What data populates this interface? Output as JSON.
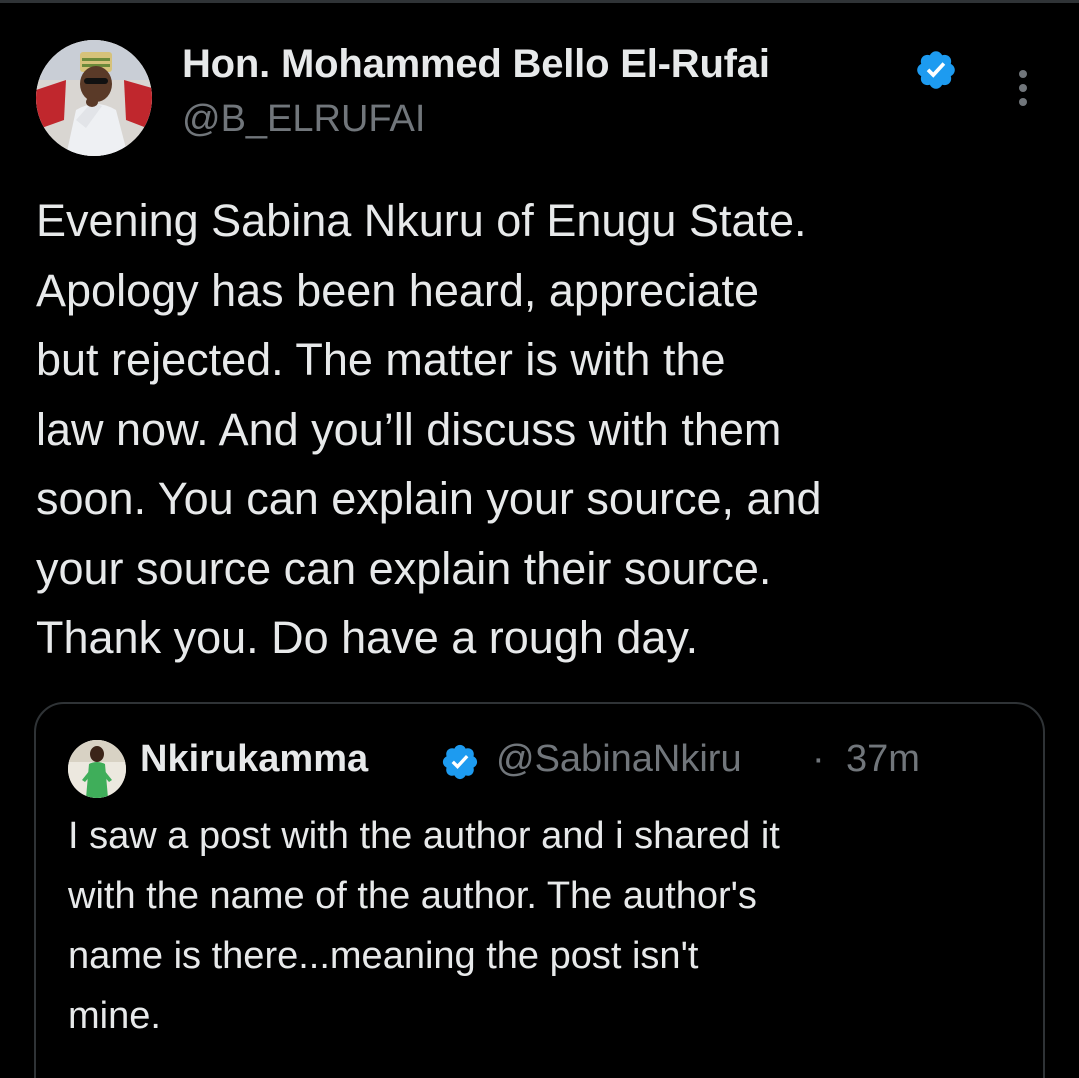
{
  "post": {
    "author": {
      "display_name": "Hon. Mohammed Bello El-Rufai",
      "handle": "@B_ELRUFAI",
      "verified_icon": "verified-badge-icon",
      "avatar_icon": "avatar"
    },
    "more_icon": "more-options-icon",
    "text_lines": [
      "Evening Sabina Nkuru of Enugu State.",
      "Apology has been heard, appreciate",
      "but rejected. The matter is with the",
      "law now. And you’ll discuss with them",
      "soon. You can explain your source, and",
      "your source can explain their source.",
      "Thank you. Do have a rough day."
    ]
  },
  "quoted_post": {
    "author": {
      "display_name": "Nkirukamma",
      "handle": "@SabinaNkiru",
      "verified_icon": "verified-badge-icon"
    },
    "separator": "·",
    "time": "37m",
    "text_lines": [
      "I saw a post with the author and i shared it",
      "with the name of the author. The author's",
      "name is there...meaning the post isn't",
      "mine."
    ]
  },
  "colors": {
    "background": "#000000",
    "text_primary": "#e7e9ea",
    "text_secondary": "#71767b",
    "border": "#2f3336",
    "verified_blue": "#1d9bf0"
  }
}
